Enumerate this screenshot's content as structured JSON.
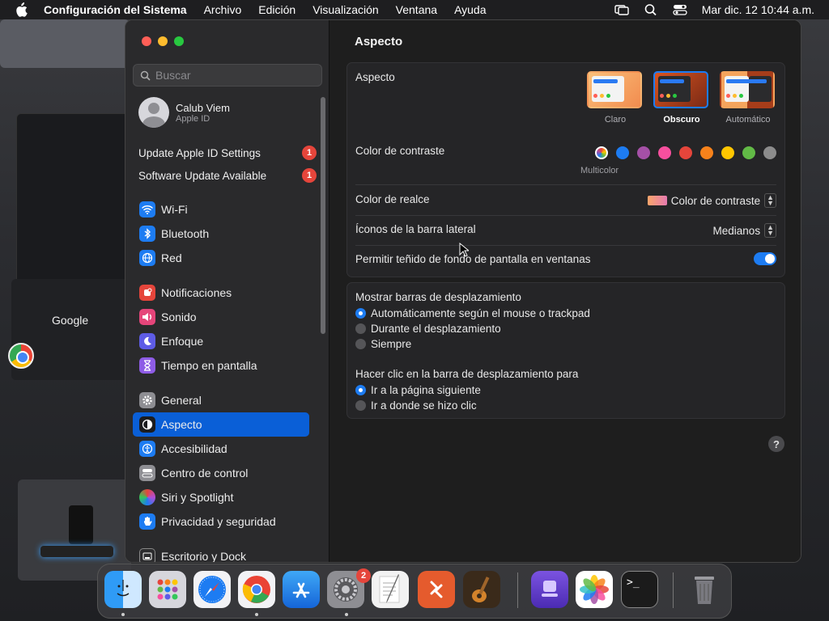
{
  "menubar": {
    "app_name": "Configuración del Sistema",
    "items": [
      "Archivo",
      "Edición",
      "Visualización",
      "Ventana",
      "Ayuda"
    ],
    "datetime": "Mar dic. 12  10:44 a.m."
  },
  "sidebar": {
    "search_placeholder": "Buscar",
    "account": {
      "name": "Calub Viem",
      "subtitle": "Apple ID"
    },
    "notices": [
      {
        "label": "Update Apple ID Settings",
        "badge": "1"
      },
      {
        "label": "Software Update Available",
        "badge": "1"
      }
    ],
    "items": [
      {
        "label": "Wi-Fi",
        "icon": "wifi-icon",
        "color": "#1d7cf2"
      },
      {
        "label": "Bluetooth",
        "icon": "bluetooth-icon",
        "color": "#1d7cf2"
      },
      {
        "label": "Red",
        "icon": "globe-icon",
        "color": "#1d7cf2"
      },
      {
        "label": "Notificaciones",
        "icon": "bell-icon",
        "color": "#e5453b"
      },
      {
        "label": "Sonido",
        "icon": "speaker-icon",
        "color": "#e5457a"
      },
      {
        "label": "Enfoque",
        "icon": "moon-icon",
        "color": "#5e5ce6"
      },
      {
        "label": "Tiempo en pantalla",
        "icon": "hourglass-icon",
        "color": "#8e5ce6"
      },
      {
        "label": "General",
        "icon": "gear-icon",
        "color": "#8e8e93"
      },
      {
        "label": "Aspecto",
        "icon": "appearance-icon",
        "color": "#1c1c1e",
        "active": true
      },
      {
        "label": "Accesibilidad",
        "icon": "accessibility-icon",
        "color": "#1d7cf2"
      },
      {
        "label": "Centro de control",
        "icon": "control-center-icon",
        "color": "#8e8e93"
      },
      {
        "label": "Siri y Spotlight",
        "icon": "siri-icon",
        "color": "#b34dd6"
      },
      {
        "label": "Privacidad y seguridad",
        "icon": "hand-icon",
        "color": "#1d7cf2"
      },
      {
        "label": "Escritorio y Dock",
        "icon": "dock-icon",
        "color": "#2c2c2e"
      }
    ]
  },
  "content": {
    "title": "Aspecto",
    "appearance": {
      "label": "Aspecto",
      "options": [
        {
          "label": "Claro",
          "selected": false
        },
        {
          "label": "Obscuro",
          "selected": true
        },
        {
          "label": "Automático",
          "selected": false
        }
      ]
    },
    "accent": {
      "label": "Color de contraste",
      "selected_label": "Multicolor",
      "colors": [
        "#ffffff",
        "#1d7cf2",
        "#a550a7",
        "#f74f9e",
        "#e5453b",
        "#f7821b",
        "#ffc600",
        "#62ba46",
        "#8c8c8c"
      ]
    },
    "highlight": {
      "label": "Color de realce",
      "value": "Color de contraste"
    },
    "sidebar_icons": {
      "label": "Íconos de la barra lateral",
      "value": "Medianos"
    },
    "tinting": {
      "label": "Permitir teñido de fondo de pantalla en ventanas",
      "on": true
    },
    "scrollbars": {
      "label": "Mostrar barras de desplazamiento",
      "options": [
        {
          "label": "Automáticamente según el mouse o trackpad",
          "selected": true
        },
        {
          "label": "Durante el desplazamiento",
          "selected": false
        },
        {
          "label": "Siempre",
          "selected": false
        }
      ]
    },
    "click_scroll": {
      "label": "Hacer clic en la barra de desplazamiento para",
      "options": [
        {
          "label": "Ir a la página siguiente",
          "selected": true
        },
        {
          "label": "Ir a donde se hizo clic",
          "selected": false
        }
      ]
    },
    "help": "?"
  },
  "background": {
    "google_text": "Google"
  },
  "dock": {
    "badge": "2",
    "apps": [
      "finder-icon",
      "launchpad-icon",
      "safari-icon",
      "chrome-icon",
      "app-store-icon",
      "system-settings-icon",
      "textedit-icon",
      "remote-desktop-icon",
      "garageband-icon",
      "podcast-capture-icon",
      "photos-icon",
      "terminal-icon",
      "trash-icon"
    ],
    "terminal_prompt": ">_"
  }
}
